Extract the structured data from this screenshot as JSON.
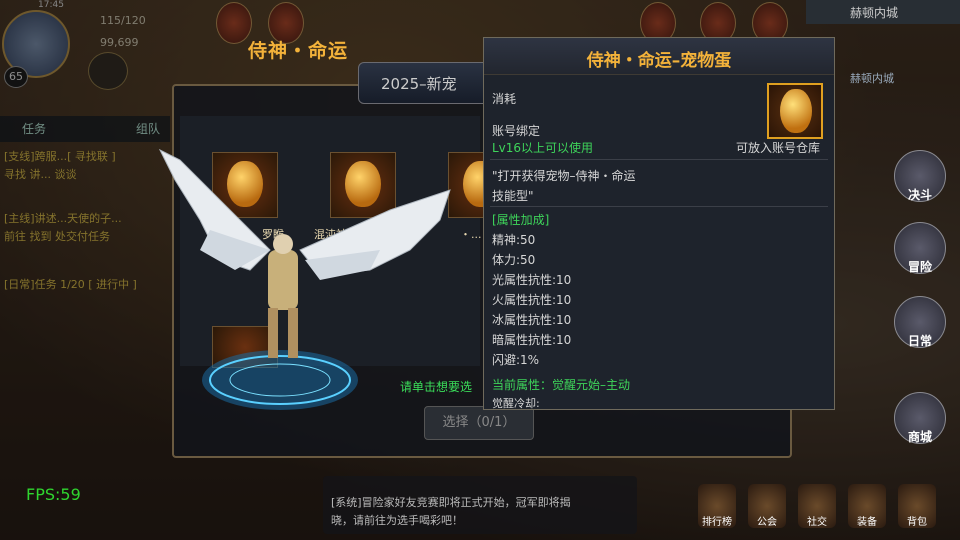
{
  "hud": {
    "time": "17:45",
    "stamina": "115/120",
    "gold": "99,699",
    "level": "65"
  },
  "quest": {
    "tab_task": "任务",
    "tab_team": "组队",
    "lines": [
      "[支线]跨服...[ 寻找联 ]",
      "寻找 讲... 谈谈",
      "[主线]讲述...天使的子...",
      "前往 找到 处交付任务",
      "[日常]任务 1/20 [ 进行中 ]"
    ]
  },
  "panel": {
    "title": "侍神・命运",
    "tab_label": "2025–新宠",
    "cells": [
      {
        "name": "罗睺"
      },
      {
        "name": "混沌神尊"
      },
      {
        "name": "・..."
      }
    ],
    "hint": "请单击想要选",
    "select_button": "选择（0/1）"
  },
  "tooltip": {
    "title": "侍神・命运–宠物蛋",
    "type": "消耗",
    "bind": "账号绑定",
    "level_req": "Lv16以上可以使用",
    "storage": "可放入账号仓库",
    "description_line1": "\"打开获得宠物–侍神・命运",
    "description_line2": "技能型\"",
    "attr_header": "[属性加成]",
    "attrs": [
      "精神:50",
      "体力:50",
      "光属性抗性:10",
      "火属性抗性:10",
      "冰属性抗性:10",
      "暗属性抗性:10",
      "闪避:1%"
    ],
    "current_attr": "当前属性：觉醒元始–主动",
    "cooldown": "觉醒冷却:"
  },
  "right": {
    "location": "赫顿内城",
    "location2": "赫顿内城",
    "buttons": [
      "决斗",
      "冒险",
      "日常",
      "商城"
    ]
  },
  "bottom": {
    "icons": [
      "排行榜",
      "公会",
      "社交",
      "装备",
      "背包"
    ]
  },
  "chat": {
    "line1": "[系统]冒险家好友竞赛即将正式开始，冠军即将揭",
    "line2": "晓，请前往为选手喝彩吧！"
  },
  "fps": "FPS:59"
}
